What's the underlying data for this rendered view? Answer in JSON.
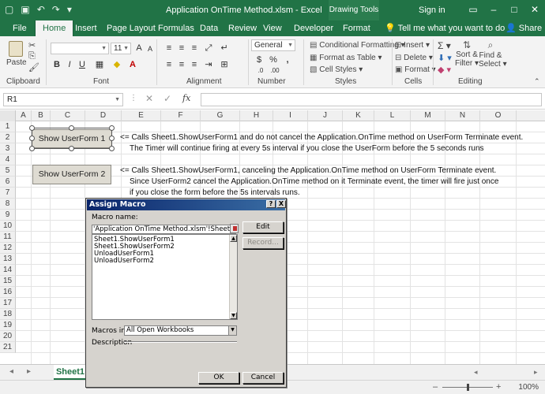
{
  "titlebar": {
    "title": "Application OnTime Method.xlsm - Excel",
    "context_tab": "Drawing Tools",
    "signin": "Sign in"
  },
  "tabs": [
    {
      "label": "File"
    },
    {
      "label": "Home"
    },
    {
      "label": "Insert"
    },
    {
      "label": "Page Layout"
    },
    {
      "label": "Formulas"
    },
    {
      "label": "Data"
    },
    {
      "label": "Review"
    },
    {
      "label": "View"
    },
    {
      "label": "Developer"
    },
    {
      "label": "Format"
    }
  ],
  "tell_me": "Tell me what you want to do",
  "share": "Share",
  "ribbon": {
    "paste": "Paste",
    "font_size": "11",
    "number_format": "General",
    "conditional_formatting": "Conditional Formatting",
    "format_as_table": "Format as Table",
    "cell_styles": "Cell Styles",
    "insert": "Insert",
    "delete": "Delete",
    "format": "Format",
    "sort_filter_1": "Sort &",
    "sort_filter_2": "Filter",
    "find_select_1": "Find &",
    "find_select_2": "Select",
    "groups": {
      "clipboard": "Clipboard",
      "font": "Font",
      "alignment": "Alignment",
      "number": "Number",
      "styles": "Styles",
      "cells": "Cells",
      "editing": "Editing"
    }
  },
  "formula_bar": {
    "name_box": "R1",
    "fx": "fx"
  },
  "grid": {
    "columns": [
      "A",
      "B",
      "C",
      "D",
      "E",
      "F",
      "G",
      "H",
      "I",
      "J",
      "K",
      "L",
      "M",
      "N",
      "O"
    ],
    "rows": [
      "1",
      "2",
      "3",
      "4",
      "5",
      "6",
      "7",
      "8",
      "9",
      "10",
      "11",
      "12",
      "13",
      "14",
      "15",
      "16",
      "17",
      "18",
      "19",
      "20",
      "21"
    ],
    "button1": "Show UserForm 1",
    "button2": "Show UserForm 2",
    "note_row2": "<= Calls Sheet1.ShowUserForm1 and do not cancel the Application.OnTime method on UserForm Terminate event.",
    "note_row3": "The Timer will continue firing at every 5s interval if you close the UserForm before the 5 seconds runs",
    "note_row5": "<= Calls Sheet1.ShowUserForm1, canceling the Application.OnTime method on UserForm Terminate event.",
    "note_row6": "Since UserForm2 cancel the Application.OnTime method on it Terminate event, the timer will fire just once",
    "note_row7": "if you close the form before the 5s intervals runs."
  },
  "sheet_tab": "Sheet1",
  "zoom": "100%",
  "dialog": {
    "title": "Assign Macro",
    "help": "?",
    "close": "X",
    "macro_name_label": "Macro name:",
    "macro_name_value": "'Application OnTime Method.xlsm'!Sheet1.Show",
    "macros": [
      "Sheet1.ShowUserForm1",
      "Sheet1.ShowUserForm2",
      "UnloadUserForm1",
      "UnloadUserForm2"
    ],
    "edit": "Edit",
    "record": "Record...",
    "macros_in_label": "Macros in:",
    "macros_in_value": "All Open Workbooks",
    "description_label": "Description",
    "ok": "OK",
    "cancel": "Cancel"
  }
}
